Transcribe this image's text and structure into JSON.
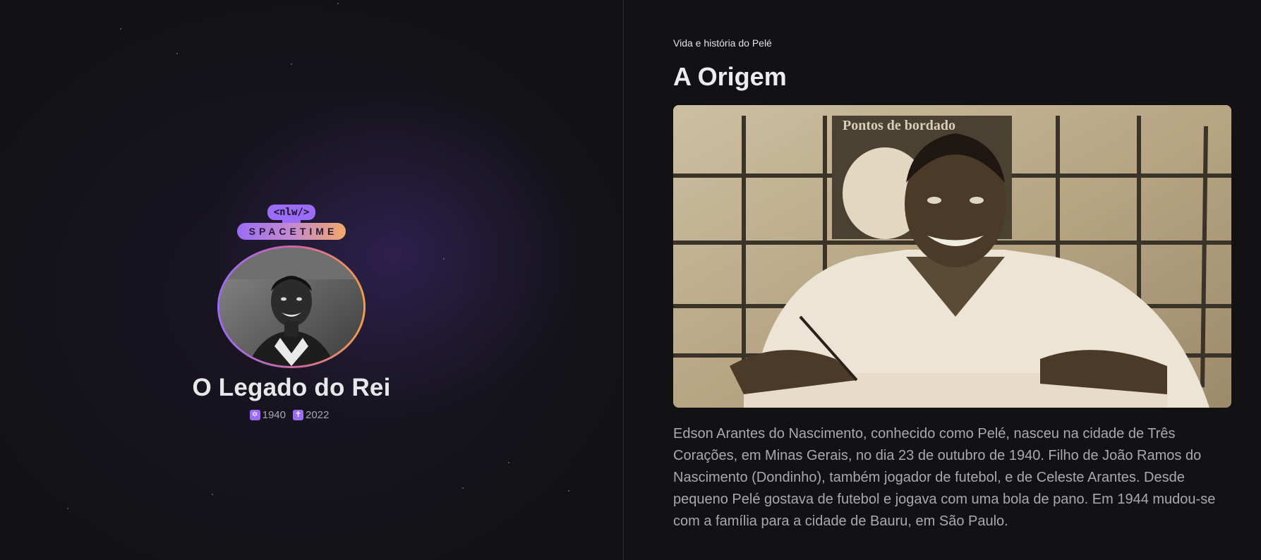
{
  "logo": {
    "tag": "<nlw/>",
    "word": "SPACETIME"
  },
  "profile": {
    "title": "O Legado do Rei",
    "birth_icon": "star-icon",
    "birth_year": "1940",
    "death_icon": "cross-icon",
    "death_year": "2022"
  },
  "memory": {
    "breadcrumb": "Vida e história do Pelé",
    "heading": "A Origem",
    "photo_sign_text": "Pontos de bordado",
    "body": "Edson Arantes do Nascimento, conhecido como Pelé, nasceu na cidade de Três Corações, em Minas Gerais, no dia 23 de outubro de 1940. Filho de João Ramos do Nascimento (Dondinho), também jogador de futebol, e de Celeste Arantes. Desde pequeno Pelé gostava de futebol e jogava com uma bola de pano. Em 1944 mudou-se com a família para a cidade de Bauru, em São Paulo."
  },
  "colors": {
    "background": "#121215",
    "accent_purple": "#9b6cf5",
    "accent_orange": "#f2a042",
    "divider": "#2e2e35"
  }
}
